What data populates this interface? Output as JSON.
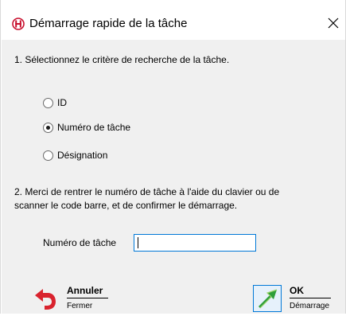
{
  "window": {
    "title": "Démarrage rapide de la tâche",
    "close_glyph": "✕"
  },
  "step1": {
    "text": "1. Sélectionnez le critère de recherche de la tâche."
  },
  "radios": [
    {
      "label": "ID",
      "checked": false
    },
    {
      "label": "Numéro de tâche",
      "checked": true
    },
    {
      "label": "Désignation",
      "checked": false
    }
  ],
  "step2": {
    "line1": "2. Merci de rentrer le numéro de tâche à l'aide du clavier ou de",
    "line2": "scanner le code barre, et de confirmer le démarrage."
  },
  "task_field": {
    "label": "Numéro de tâche",
    "value": ""
  },
  "actions": {
    "cancel": {
      "title": "Annuler",
      "subtitle": "Fermer",
      "icon": "undo-arrow-icon"
    },
    "ok": {
      "title": "OK",
      "subtitle": "Démarrage",
      "icon": "go-arrow-icon"
    }
  },
  "colors": {
    "accent": "#0078d7",
    "panel": "#f0f0f0",
    "cancel_icon": "#d9232e",
    "ok_icon": "#2e9e3a",
    "app_icon": "#c8102e"
  }
}
